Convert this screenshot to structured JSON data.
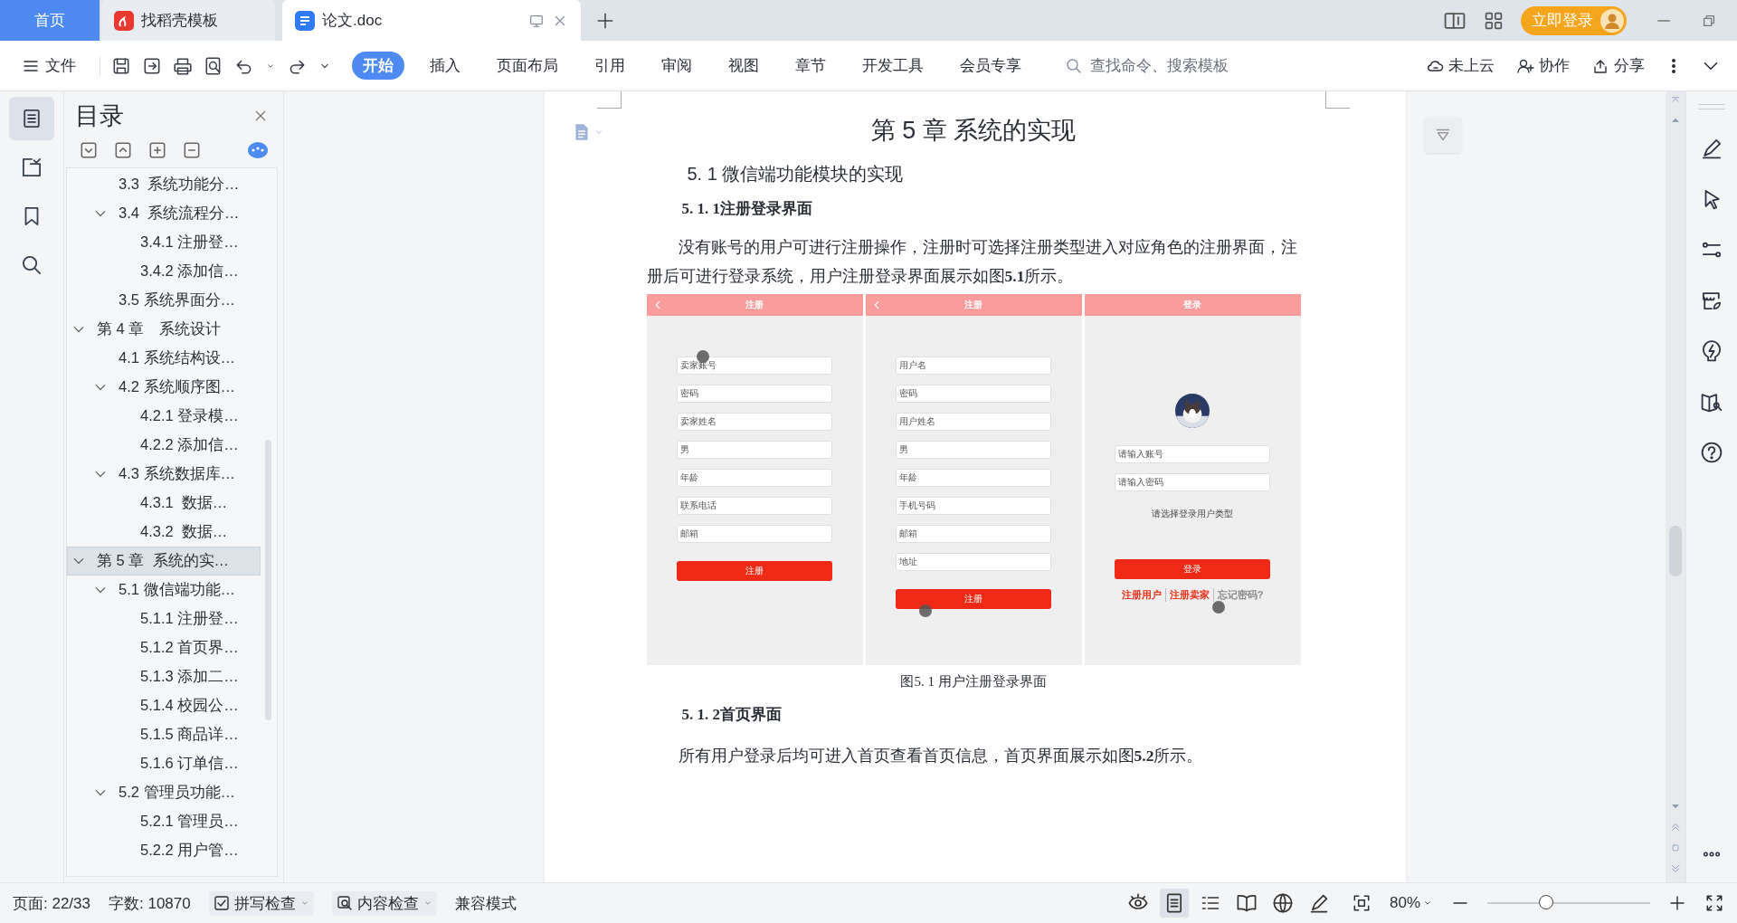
{
  "tabs": [
    {
      "label": "首页",
      "kind": "home",
      "selected": false
    },
    {
      "label": "找稻壳模板",
      "kind": "web",
      "selected": false
    },
    {
      "label": "论文.doc",
      "kind": "doc",
      "selected": true
    }
  ],
  "account": {
    "login_button": "立即登录"
  },
  "menu": {
    "file": "文件",
    "ribbon_tabs": [
      {
        "label": "开始",
        "selected": true
      },
      {
        "label": "插入",
        "selected": false
      },
      {
        "label": "页面布局",
        "selected": false
      },
      {
        "label": "引用",
        "selected": false
      },
      {
        "label": "审阅",
        "selected": false
      },
      {
        "label": "视图",
        "selected": false
      },
      {
        "label": "章节",
        "selected": false
      },
      {
        "label": "开发工具",
        "selected": false
      },
      {
        "label": "会员专享",
        "selected": false
      }
    ],
    "search": {
      "placeholder": "查找命令、搜索模板"
    },
    "actions": [
      {
        "label": "未上云",
        "kind": "cloud"
      },
      {
        "label": "协作",
        "kind": "collab"
      },
      {
        "label": "分享",
        "kind": "share"
      }
    ]
  },
  "left_rail": [
    {
      "kind": "toc",
      "selected": true
    },
    {
      "kind": "nav",
      "selected": false
    },
    {
      "kind": "bookmark",
      "selected": false
    },
    {
      "kind": "search",
      "selected": false
    }
  ],
  "toc": {
    "title": "目录",
    "items": [
      {
        "children": [
          {
            "label": "3.3  系统功能分…",
            "selected": false
          },
          {
            "label": "3.4  系统流程分…",
            "selected": false,
            "expanded": true,
            "children": [
              {
                "label": "3.4.1 注册登…",
                "selected": false
              },
              {
                "label": "3.4.2 添加信…",
                "selected": false
              }
            ]
          },
          {
            "label": "3.5 系统界面分…",
            "selected": false
          }
        ]
      },
      {
        "label": "第 4 章　系统设计",
        "selected": false,
        "expanded": true,
        "children": [
          {
            "label": "4.1 系统结构设…",
            "selected": false
          },
          {
            "label": "4.2 系统顺序图…",
            "selected": false,
            "expanded": true,
            "children": [
              {
                "label": "4.2.1 登录模…",
                "selected": false
              },
              {
                "label": "4.2.2 添加信…",
                "selected": false
              }
            ]
          },
          {
            "label": "4.3 系统数据库…",
            "selected": false,
            "expanded": true,
            "children": [
              {
                "label": "4.3.1  数据…",
                "selected": false
              },
              {
                "label": "4.3.2  数据…",
                "selected": false
              }
            ]
          }
        ]
      },
      {
        "label": "第 5 章  系统的实…",
        "selected": true,
        "expanded": true,
        "children": [
          {
            "label": "5.1 微信端功能…",
            "selected": false,
            "expanded": true,
            "children": [
              {
                "label": "5.1.1 注册登…",
                "selected": false
              },
              {
                "label": "5.1.2 首页界…",
                "selected": false
              },
              {
                "label": "5.1.3 添加二…",
                "selected": false
              },
              {
                "label": "5.1.4 校园公…",
                "selected": false
              },
              {
                "label": "5.1.5 商品详…",
                "selected": false
              },
              {
                "label": "5.1.6 订单信…",
                "selected": false
              }
            ]
          },
          {
            "label": "5.2 管理员功能…",
            "selected": false,
            "expanded": true,
            "children": [
              {
                "label": "5.2.1 管理员…",
                "selected": false
              },
              {
                "label": "5.2.2 用户管…",
                "selected": false
              }
            ]
          }
        ]
      }
    ]
  },
  "document": {
    "title": "第 5 章  系统的实现",
    "section": "5. 1 微信端功能模块的实现",
    "subsection": "5. 1. 1注册登录界面",
    "paragraph": "没有账号的用户可进行注册操作，注册时可选择注册类型进入对应角色的注册界面，注册后可进行登录系统，用户注册登录界面展示如图**5.1**所示。",
    "figure": {
      "screens": [
        {
          "title": "注册",
          "back": true,
          "fields": [
            "卖家账号",
            "密码",
            "卖家姓名",
            "男",
            "年龄",
            "联系电话",
            "邮箱"
          ],
          "button": "注册"
        },
        {
          "title": "注册",
          "back": true,
          "fields": [
            "用户名",
            "密码",
            "用户姓名",
            "男",
            "年龄",
            "手机号码",
            "邮箱",
            "地址"
          ],
          "button": "注册"
        },
        {
          "title": "登录",
          "back": false,
          "avatar": {
            "kind": "picture"
          },
          "fields": [
            "请输入账号",
            "请输入密码"
          ],
          "note": "请选择登录用户类型",
          "button": "登录",
          "links": [
            {
              "label": "注册用户",
              "color": "#e8341c"
            },
            {
              "label": "注册卖家",
              "color": "#e8341c"
            },
            {
              "label": "忘记密码?",
              "color": "#8a8a8a"
            }
          ]
        }
      ],
      "caption": "图5. 1  用户注册登录界面"
    },
    "subsection_2": "5. 1. 2首页界面",
    "paragraph_2": "所有用户登录后均可进入首页查看首页信息，首页界面展示如图**5.2**所示。"
  },
  "right_rail": [
    {
      "kind": "pen"
    },
    {
      "kind": "cursor"
    },
    {
      "kind": "sliders"
    },
    {
      "kind": "store"
    },
    {
      "kind": "bulb"
    },
    {
      "kind": "book"
    },
    {
      "kind": "help"
    }
  ],
  "status_bar": {
    "page": "页面: 22/33",
    "words": "字数: 10870",
    "tools": [
      {
        "label": "拼写检查",
        "kind": "spell"
      },
      {
        "label": "内容检查",
        "kind": "content"
      }
    ],
    "mode": "兼容模式",
    "view_modes": [
      {
        "kind": "eye",
        "selected": false
      },
      {
        "kind": "page",
        "selected": true
      },
      {
        "kind": "outline",
        "selected": false
      },
      {
        "kind": "read",
        "selected": false
      },
      {
        "kind": "web",
        "selected": false
      },
      {
        "kind": "pen",
        "selected": false
      }
    ],
    "zoom": {
      "reading": "80%",
      "level": 0.36
    }
  }
}
